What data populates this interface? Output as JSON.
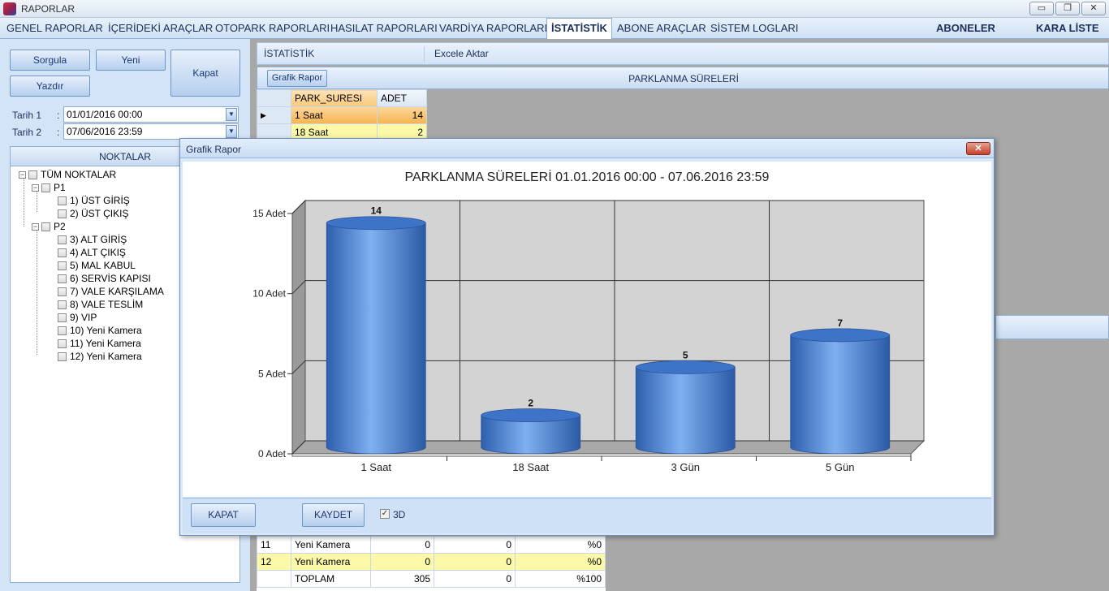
{
  "app": {
    "title": "RAPORLAR",
    "min": "▭",
    "restore": "❐",
    "close": "✕"
  },
  "menu": {
    "items": [
      "GENEL RAPORLAR",
      "İÇERİDEKİ ARAÇLAR",
      "OTOPARK RAPORLARI",
      "HASILAT RAPORLARI",
      "VARDİYA RAPORLARI",
      "İSTATİSTİK",
      "ABONE ARAÇLAR",
      "SİSTEM LOGLARI"
    ],
    "active": "İSTATİSTİK",
    "right": [
      "ABONELER",
      "KARA LİSTE"
    ]
  },
  "left": {
    "sorgula": "Sorgula",
    "yeni": "Yeni",
    "kapat": "Kapat",
    "yazdir": "Yazdır",
    "tarih1_label": "Tarih 1",
    "tarih1": "01/01/2016 00:00",
    "tarih2_label": "Tarih 2",
    "tarih2": "07/06/2016 23:59",
    "colon": ":",
    "tree_header": "NOKTALAR",
    "tree": {
      "root": "TÜM NOKTALAR",
      "p1": "P1",
      "p1_children": [
        "1) ÜST GİRİŞ",
        "2) ÜST ÇIKIŞ"
      ],
      "p2": "P2",
      "p2_children": [
        "3) ALT GİRİŞ",
        "4) ALT ÇIKIŞ",
        "5) MAL KABUL",
        "6) SERVİS KAPISI",
        "7) VALE KARŞILAMA",
        "8) VALE TESLİM",
        "9) VIP",
        "10) Yeni Kamera",
        "11) Yeni Kamera",
        "12) Yeni Kamera"
      ]
    }
  },
  "right": {
    "istatistik": "İSTATİSTİK",
    "excel": "Excele Aktar",
    "grafik_btn": "Grafik Rapor",
    "section_title": "PARKLANMA SÜRELERİ",
    "grid1": {
      "headers": [
        "PARK_SURESI",
        "ADET"
      ],
      "rows": [
        [
          "1 Saat",
          "14"
        ],
        [
          "18 Saat",
          "2"
        ]
      ]
    },
    "grid2": {
      "rows": [
        [
          "11",
          "Yeni Kamera",
          "0",
          "0",
          "%0"
        ],
        [
          "12",
          "Yeni Kamera",
          "0",
          "0",
          "%0"
        ],
        [
          "",
          "TOPLAM",
          "305",
          "0",
          "%100"
        ]
      ]
    }
  },
  "modal": {
    "title": "Grafik Rapor",
    "close": "✕",
    "kapat": "KAPAT",
    "kaydet": "KAYDET",
    "check3d": "3D",
    "check3d_checked": true
  },
  "chart_data": {
    "type": "bar",
    "title": "PARKLANMA SÜRELERİ      01.01.2016 00:00 - 07.06.2016 23:59",
    "categories": [
      "1 Saat",
      "18 Saat",
      "3 Gün",
      "5 Gün"
    ],
    "values": [
      14,
      2,
      5,
      7
    ],
    "y_ticks": [
      "0 Adet",
      "5 Adet",
      "10 Adet",
      "15 Adet"
    ],
    "ylim": [
      0,
      15
    ],
    "grid": true,
    "style": "3d-cylinder",
    "bar_color": "#4f86d8"
  }
}
